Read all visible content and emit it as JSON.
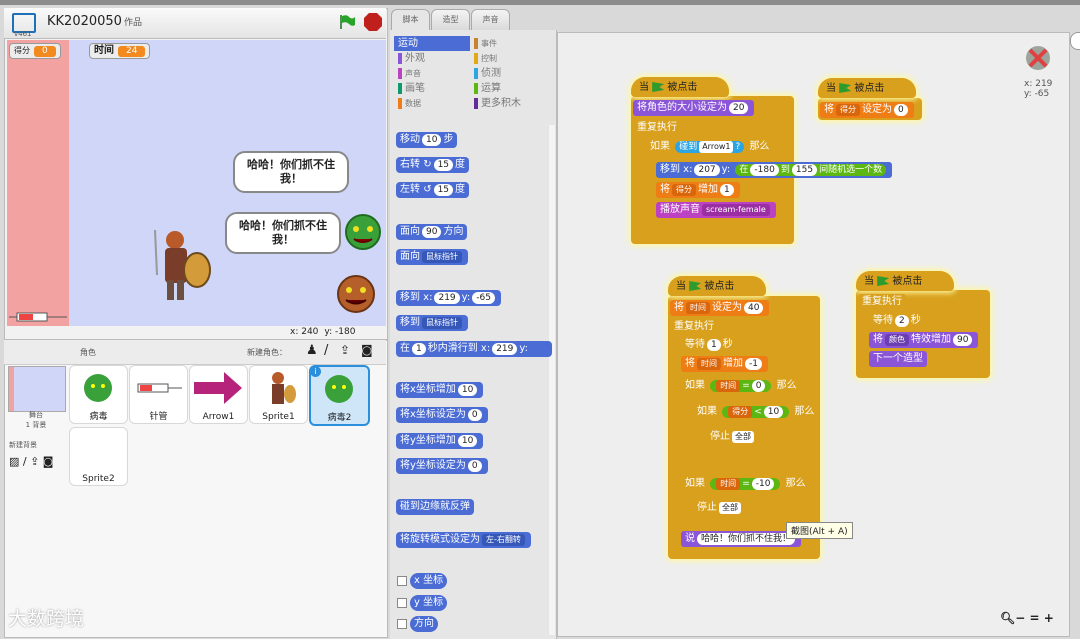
{
  "app": {
    "version": "v461",
    "project_title": "KK2020050",
    "project_suffix": "作品"
  },
  "monitors": {
    "score_label": "得分",
    "score_value": "0",
    "time_label": "时间",
    "time_value": "24"
  },
  "stage": {
    "bubble1": "哈哈！你们抓不住我！",
    "bubble2": "哈哈！你们抓不住我！",
    "coords_x": "240",
    "coords_y": "-180"
  },
  "sprites": {
    "header": "角色",
    "new_label": "新建角色：",
    "stage_tile_label": "舞台\n1 背景",
    "new_backdrop_label": "新建背景",
    "items": [
      {
        "label": "病毒"
      },
      {
        "label": "针管"
      },
      {
        "label": "Arrow1"
      },
      {
        "label": "Sprite1"
      },
      {
        "label": "病毒2"
      },
      {
        "label": "Sprite2"
      }
    ]
  },
  "tabs": [
    "脚本",
    "造型",
    "声音"
  ],
  "categories": [
    {
      "label": "运动",
      "color": "#4a6cd4"
    },
    {
      "label": "事件",
      "color": "#c88330"
    },
    {
      "label": "外观",
      "color": "#8a55d7"
    },
    {
      "label": "控制",
      "color": "#e1a91a"
    },
    {
      "label": "声音",
      "color": "#bb42c3"
    },
    {
      "label": "侦测",
      "color": "#2ca5e2"
    },
    {
      "label": "画笔",
      "color": "#0e9a6c"
    },
    {
      "label": "运算",
      "color": "#5cb712"
    },
    {
      "label": "数据",
      "color": "#ee7d16"
    },
    {
      "label": "更多积木",
      "color": "#632d99"
    }
  ],
  "palette": {
    "move": "移动",
    "move_val": "10",
    "steps": "步",
    "turn_r": "右转",
    "turn_l": "左转",
    "turn_val": "15",
    "deg": "度",
    "point_dir": "面向",
    "dir_val": "90",
    "direction": "方向",
    "point_towards": "面向",
    "mouse_ptr": "鼠标指针",
    "goto_xy": "移到 x:",
    "x_val": "219",
    "y_label": "y:",
    "y_val": "-65",
    "goto": "移到",
    "mouse_ptr2": "鼠标指针",
    "glide_in": "在",
    "glide_secs": "1",
    "glide_text": "秒内滑行到 x:",
    "glide_x": "219",
    "glide_y": "y:",
    "change_x": "将x坐标增加",
    "change_x_val": "10",
    "set_x": "将x坐标设定为",
    "set_x_val": "0",
    "change_y": "将y坐标增加",
    "change_y_val": "10",
    "set_y": "将y坐标设定为",
    "set_y_val": "0",
    "bounce": "碰到边缘就反弹",
    "rotation": "将旋转模式设定为",
    "rotation_val": "左-右翻转",
    "rep_x": "x 坐标",
    "rep_y": "y 坐标",
    "rep_dir": "方向"
  },
  "scripts": {
    "when_clicked": "当",
    "clicked": "被点击",
    "s1_size": "将角色的大小设定为",
    "s1_size_val": "20",
    "forever": "重复执行",
    "if": "如果",
    "touching": "碰到",
    "arrow": "Arrow1",
    "q": "?",
    "then": "那么",
    "goto_x": "移到 x:",
    "gx": "207",
    "gy_label": "y:",
    "in": "在",
    "r1": "-180",
    "to": "到",
    "r2": "155",
    "rand": "间随机选一个数",
    "set": "将",
    "score": "得分",
    "incr": "增加",
    "one": "1",
    "play": "播放声音",
    "sound": "scream-female",
    "s2_set_score": "设定为",
    "s2_zero": "0",
    "time": "时间",
    "set_to": "设定为",
    "forty": "40",
    "wait": "等待",
    "secs": "秒",
    "minus1": "-1",
    "eq": "=",
    "lt": "<",
    "ten": "10",
    "neg10": "-10",
    "stop": "停止",
    "all": "全部",
    "say": "说",
    "say_text": "哈哈！你们抓不住我！",
    "tooltip": "截图(Alt + A)",
    "two": "2",
    "color": "颜色",
    "effect_incr": "特效增加",
    "ninety": "90",
    "next_costume": "下一个造型"
  },
  "script_coords": {
    "x": "x: 219",
    "y": "y: -65"
  },
  "watermark": "大数跨境"
}
